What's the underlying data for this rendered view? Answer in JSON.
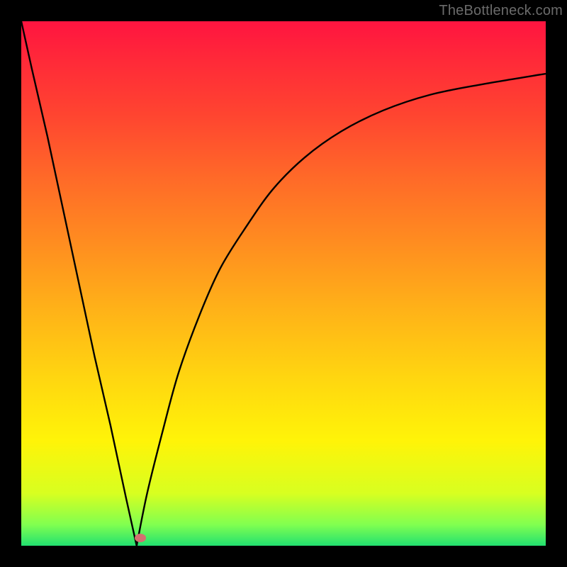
{
  "watermark": "TheBottleneck.com",
  "chart_data": {
    "type": "line",
    "title": "",
    "xlabel": "",
    "ylabel": "",
    "xlim": [
      0,
      100
    ],
    "ylim": [
      0,
      100
    ],
    "grid": false,
    "legend": false,
    "series": [
      {
        "name": "left-branch",
        "x": [
          0,
          2,
          5,
          8,
          11,
          14,
          17,
          20,
          22
        ],
        "values": [
          100,
          91,
          78,
          64,
          50,
          36,
          23,
          9,
          0
        ]
      },
      {
        "name": "right-branch",
        "x": [
          22,
          24,
          27,
          30,
          34,
          38,
          43,
          48,
          54,
          61,
          69,
          78,
          88,
          100
        ],
        "values": [
          0,
          10,
          22,
          33,
          44,
          53,
          61,
          68,
          74,
          79,
          83,
          86,
          88,
          90
        ]
      }
    ],
    "marker": {
      "name": "optimal-point",
      "x": 22.7,
      "y": 1.5,
      "color": "#d46f70"
    },
    "background_gradient": {
      "top": "#ff1440",
      "mid": "#ffd610",
      "bottom": "#22e070"
    }
  }
}
